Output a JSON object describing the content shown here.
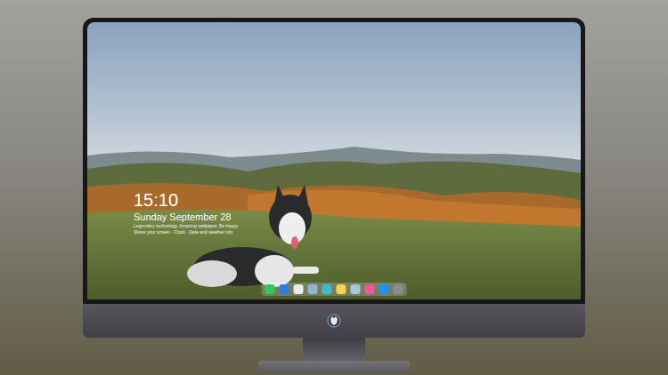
{
  "screen": {
    "lock": {
      "time": "15:10",
      "date": "Sunday September 28",
      "lines": [
        "Legendary technology. Amazing wallpaper. Be happy",
        "Share your screen · Clock · Date and weather info"
      ]
    },
    "dock": [
      {
        "color": "#34c759"
      },
      {
        "color": "#2f7de1"
      },
      {
        "color": "#e9ecef"
      },
      {
        "color": "#8fb5d8"
      },
      {
        "color": "#3fb8d6"
      },
      {
        "color": "#f5d34a"
      },
      {
        "color": "#a8c6e0"
      },
      {
        "color": "#f2559a"
      },
      {
        "color": "#1e90ff"
      },
      {
        "color": "#8a8d93"
      }
    ]
  }
}
